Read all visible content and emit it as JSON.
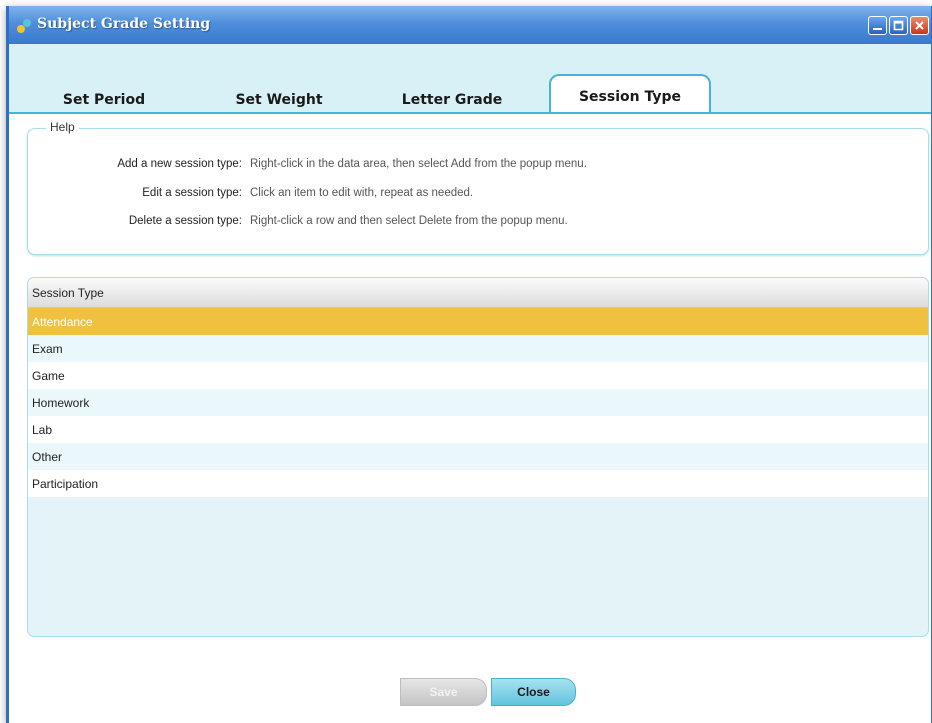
{
  "window": {
    "title": "Subject Grade Setting"
  },
  "tabs": [
    {
      "label": "Set Period",
      "active": false
    },
    {
      "label": "Set Weight",
      "active": false
    },
    {
      "label": "Letter Grade",
      "active": false
    },
    {
      "label": "Session Type",
      "active": true
    }
  ],
  "help": {
    "legend": "Help",
    "rows": [
      {
        "label": "Add a new session type:",
        "desc": "Right-click in the data area, then select Add from the popup menu."
      },
      {
        "label": "Edit a session type:",
        "desc": "Click an item to edit with, repeat as needed."
      },
      {
        "label": "Delete a session type:",
        "desc": "Right-click a row and then select Delete from the popup menu."
      }
    ]
  },
  "grid": {
    "column_header": "Session Type",
    "rows": [
      {
        "value": "Attendance",
        "selected": true
      },
      {
        "value": "Exam",
        "selected": false
      },
      {
        "value": "Game",
        "selected": false
      },
      {
        "value": "Homework",
        "selected": false
      },
      {
        "value": "Lab",
        "selected": false
      },
      {
        "value": "Other",
        "selected": false
      },
      {
        "value": "Participation",
        "selected": false
      }
    ]
  },
  "buttons": {
    "save_label": "Save",
    "close_label": "Close"
  },
  "colors": {
    "accent": "#46b4d3",
    "selected_row": "#f0c040",
    "titlebar": "#3a78cc"
  }
}
